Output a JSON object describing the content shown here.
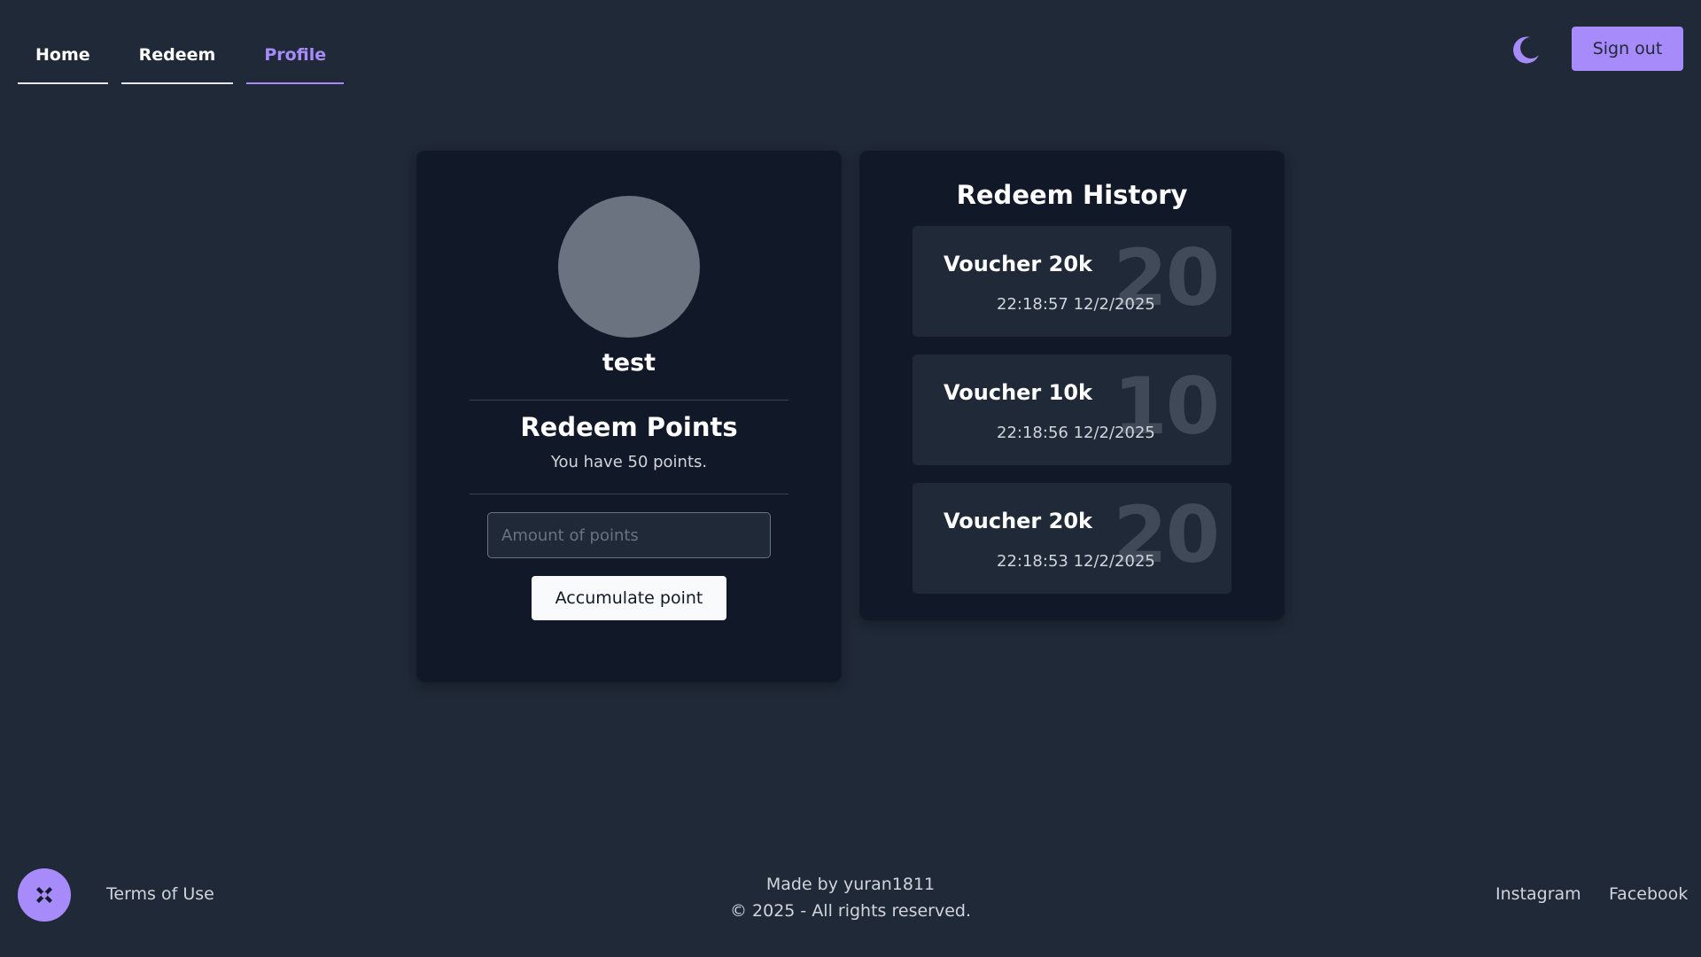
{
  "nav": {
    "tabs": [
      {
        "label": "Home"
      },
      {
        "label": "Redeem"
      },
      {
        "label": "Profile"
      }
    ],
    "active_tab": "Profile",
    "theme_icon": "moon-icon",
    "sign_out_label": "Sign out"
  },
  "profile": {
    "username": "test",
    "redeem_title": "Redeem Points",
    "points_text": "You have 50 points.",
    "amount_placeholder": "Amount of points",
    "amount_value": "",
    "accumulate_label": "Accumulate point"
  },
  "history": {
    "title": "Redeem History",
    "items": [
      {
        "name": "Voucher 20k",
        "time": "22:18:57 12/2/2025",
        "big": "20"
      },
      {
        "name": "Voucher 10k",
        "time": "22:18:56 12/2/2025",
        "big": "10"
      },
      {
        "name": "Voucher 20k",
        "time": "22:18:53 12/2/2025",
        "big": "20"
      }
    ]
  },
  "footer": {
    "logo_icon": "puzzle-logo-icon",
    "terms_label": "Terms of Use",
    "made_by": "Made by yuran1811",
    "copyright": "© 2025 - All rights reserved.",
    "instagram_label": "Instagram",
    "facebook_label": "Facebook"
  },
  "colors": {
    "background": "#1f2937",
    "card": "#111827",
    "accent": "#a78bfa",
    "avatar": "#6b7280"
  }
}
